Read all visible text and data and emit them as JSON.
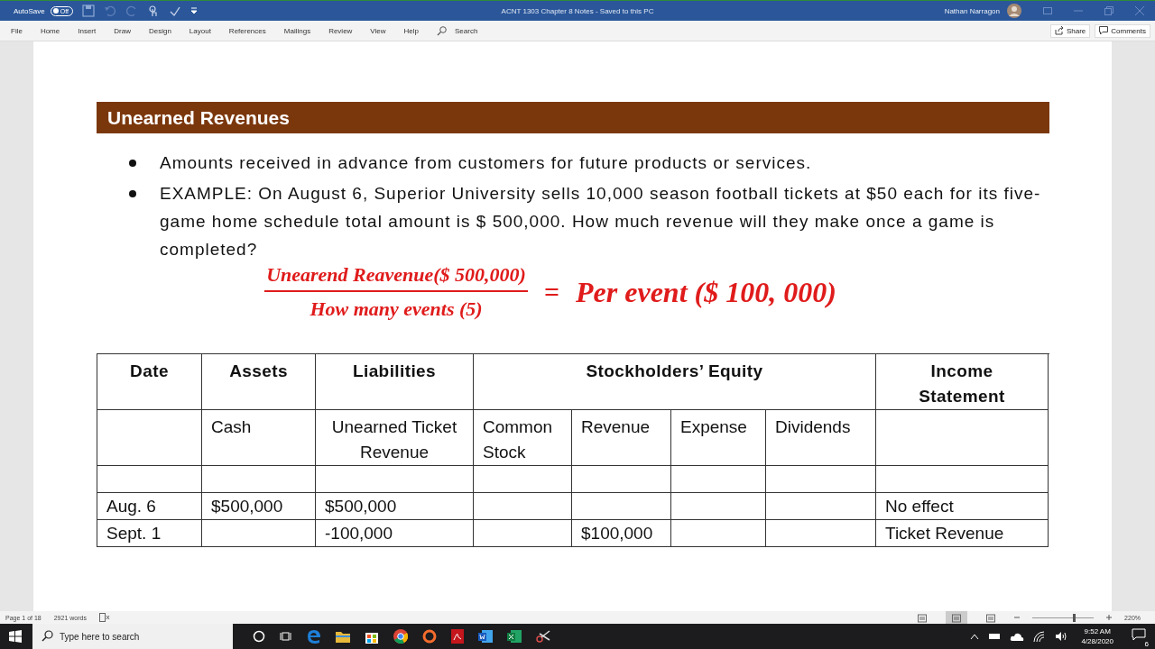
{
  "title_bar": {
    "autosave": {
      "label": "AutoSave",
      "on": false,
      "state_label": "Off"
    },
    "title": "ACNT 1303 Chapter 8 Notes  -  Saved to this PC",
    "user": "Nathan Narragon"
  },
  "ribbon_tabs": [
    {
      "label": "File",
      "selected": false
    },
    {
      "label": "Home",
      "selected": false
    },
    {
      "label": "Insert",
      "selected": false
    },
    {
      "label": "Draw",
      "selected": false
    },
    {
      "label": "Design",
      "selected": false
    },
    {
      "label": "Layout",
      "selected": false
    },
    {
      "label": "References",
      "selected": false
    },
    {
      "label": "Mailings",
      "selected": false
    },
    {
      "label": "Review",
      "selected": false
    },
    {
      "label": "View",
      "selected": false
    },
    {
      "label": "Help",
      "selected": false
    }
  ],
  "search": {
    "placeholder": "Search"
  },
  "share_button": "Share",
  "comments_button": "Comments",
  "document": {
    "heading": "Unearned Revenues",
    "bullets": [
      "Amounts received in advance from customers for future products or services.",
      "EXAMPLE: On August 6, Superior University sells 10,000 season football tickets at $50 each for its five-game home schedule total amount is $ 500,000. How much revenue will they make once a game is completed?"
    ],
    "formula": {
      "numerator": "Unearend Reavenue($ 500,000)",
      "denominator": "How many events (5)",
      "equals": "=",
      "result": "Per event ($ 100, 000)"
    },
    "table": {
      "groups": [
        {
          "label": "Date",
          "subcolumns": [
            {}
          ]
        },
        {
          "label": "Assets",
          "subcolumns": [
            {
              "label": "Cash"
            }
          ]
        },
        {
          "label": "Liabilities",
          "subcolumns": [
            {
              "label": "Unearned Ticket Revenue"
            }
          ]
        },
        {
          "label": "Stockholders’ Equity",
          "subcolumns": [
            {
              "label": "Common Stock"
            },
            {
              "label": "Revenue"
            },
            {
              "label": "Expense"
            },
            {
              "label": "Dividends"
            }
          ]
        },
        {
          "label": "Income Statement",
          "subcolumns": [
            {}
          ]
        }
      ],
      "rows": [
        {
          "cells": [
            {},
            {},
            {},
            {},
            {},
            {},
            {},
            {}
          ]
        },
        {
          "cells": [
            {
              "text": "Aug. 6"
            },
            {
              "text": "$500,000"
            },
            {
              "text": "$500,000"
            },
            {},
            {},
            {},
            {},
            {
              "text": "No effect"
            }
          ]
        },
        {
          "cells": [
            {
              "text": "Sept. 1"
            },
            {},
            {
              "text": "-100,000"
            },
            {},
            {
              "text": "$100,000"
            },
            {},
            {},
            {
              "text": "Ticket Revenue"
            }
          ]
        }
      ]
    }
  },
  "status_bar": {
    "page": "Page 1 of 18",
    "words": "2921 words",
    "views": [
      {
        "selected": false
      },
      {
        "selected": true
      },
      {
        "selected": false
      }
    ],
    "zoom": {
      "level": 0.68,
      "reading": "220%"
    }
  },
  "taskbar": {
    "search_placeholder": "Type here to search",
    "time": "9:52 AM",
    "date": "4/28/2020",
    "notifications": "6"
  }
}
